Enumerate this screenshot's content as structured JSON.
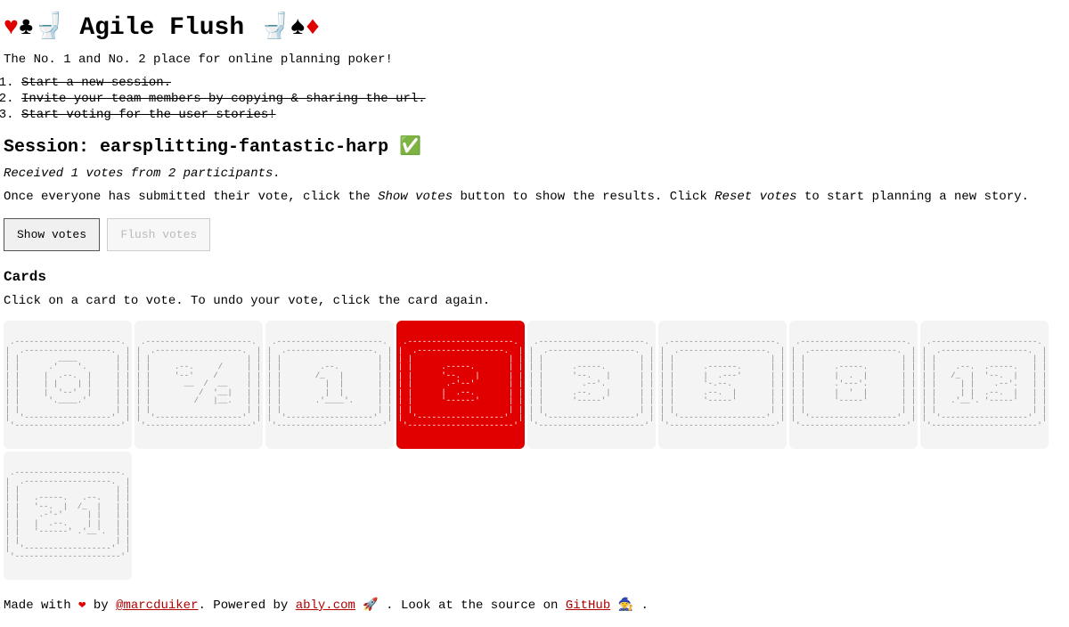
{
  "header": {
    "title_prefix_hearts": "♥",
    "title_prefix_clubs": "♣",
    "title_prefix_toilet": "🚽",
    "title_text": "Agile Flush",
    "title_suffix_toilet": "🚽",
    "title_suffix_spades": "♠",
    "title_suffix_diamonds": "♦"
  },
  "subtitle": "The No. 1 and No. 2 place for online planning poker!",
  "steps": [
    "Start a new session.",
    "Invite your team members by copying & sharing the url.",
    "Start voting for the user stories!"
  ],
  "session": {
    "label": "Session: ",
    "name": "earsplitting-fantastic-harp",
    "check": "✅"
  },
  "status": "Received 1 votes from 2 participants.",
  "instructions": {
    "part1": "Once everyone has submitted their vote, click the ",
    "show_votes_italic": "Show votes",
    "part2": " button to show the results. Click ",
    "reset_votes_italic": "Reset votes",
    "part3": " to start planning a new story."
  },
  "buttons": {
    "show_votes": "Show votes",
    "flush_votes": "Flush votes"
  },
  "cards_heading": "Cards",
  "cards_help": "Click on a card to vote. To undo your vote, click the card again.",
  "cards": [
    {
      "value": "0",
      "selected": false
    },
    {
      "value": "½",
      "selected": false
    },
    {
      "value": "1",
      "selected": false
    },
    {
      "value": "2",
      "selected": true
    },
    {
      "value": "3",
      "selected": false
    },
    {
      "value": "5",
      "selected": false
    },
    {
      "value": "8",
      "selected": false
    },
    {
      "value": "13",
      "selected": false
    },
    {
      "value": "21",
      "selected": false
    }
  ],
  "card_art": {
    "0": " .----------------------. \n|  .------------------.  |\n| |        ____        | |\n| |      .'    '.      | |\n| |     |  .--.  |     | |\n| |     | |    | |     | |\n| |     |  '--'  |     | |\n| |      '.____.'      | |\n| |                    | |\n|  '------------------'  |\n '----------------------' ",
    "½": " .----------------------. \n|  .------------------.  |\n| |                    | |\n| |     .--.     /     | |\n| |     '--'    /      | |\n| |       __  /  __    | |\n| |          /  '__|   | |\n| |         /   |__.   | |\n| |                    | |\n|  '------------------'  |\n '----------------------' ",
    "1": " .----------------------. \n|  .------------------.  |\n| |                    | |\n| |        .--.        | |\n| |       /_   |       | |\n| |         |  |       | |\n| |         |  |       | |\n| |       .'____'.     | |\n| |                    | |\n|  '------------------'  |\n '----------------------' ",
    "2": " .----------------------. \n|  .------------------.  |\n| |                    | |\n| |      .-----.       | |\n| |      '--.   |      | |\n| |       .-'--'       | |\n| |      |  .--.       | |\n| |      '------'      | |\n| |                    | |\n|  '------------------'  |\n '----------------------' ",
    "3": " .----------------------. \n|  .------------------.  |\n| |                    | |\n| |      .-----.       | |\n| |      '--.   |      | |\n| |        .--'.       | |\n| |      .--.   |      | |\n| |      '-----'       | |\n| |                    | |\n|  '------------------'  |\n '----------------------' ",
    "5": " .----------------------. \n|  .------------------.  |\n| |                    | |\n| |      .------.      | |\n| |      |  .---'      | |\n| |      '-.--.        | |\n| |      .--.  |       | |\n| |      '-----'       | |\n| |                    | |\n|  '------------------'  |\n '----------------------' ",
    "8": " .----------------------. \n|  .------------------.  |\n| |                    | |\n| |      .-----.       | |\n| |      |  .  |       | |\n| |      .'---'.       | |\n| |      |  '  |       | |\n| |      '-----'       | |\n| |                    | |\n|  '------------------'  |\n '----------------------' ",
    "13": " .----------------------. \n|  .------------------.  |\n| |                    | |\n| |    .--.  .-----.   | |\n| |   /_  |  '--.  |   | |\n| |     | |    .--'.   | |\n| |     | |  .--.  |   | |\n| |   .'__'. '-----'   | |\n| |                    | |\n|  '------------------'  |\n '----------------------' ",
    "21": " .----------------------. \n|  .------------------.  |\n| |                    | |\n| |   .-----.   .--.   | |\n| |   '--.  |  /_  |   | |\n| |    .-'-'     | |   | |\n| |   |  .--.    | |   | |\n| |   '------' .'__'.  | |\n| |                    | |\n|  '------------------'  |\n '----------------------' "
  },
  "footer": {
    "made_with": "Made with ",
    "heart": "❤",
    "by": " by ",
    "author": "@marcduiker",
    "powered": ". Powered by ",
    "ably": "ably.com",
    "rocket": " 🚀",
    "look": " . Look at the source on ",
    "github": "GitHub",
    "detective": " 🧙",
    "period": " ."
  }
}
